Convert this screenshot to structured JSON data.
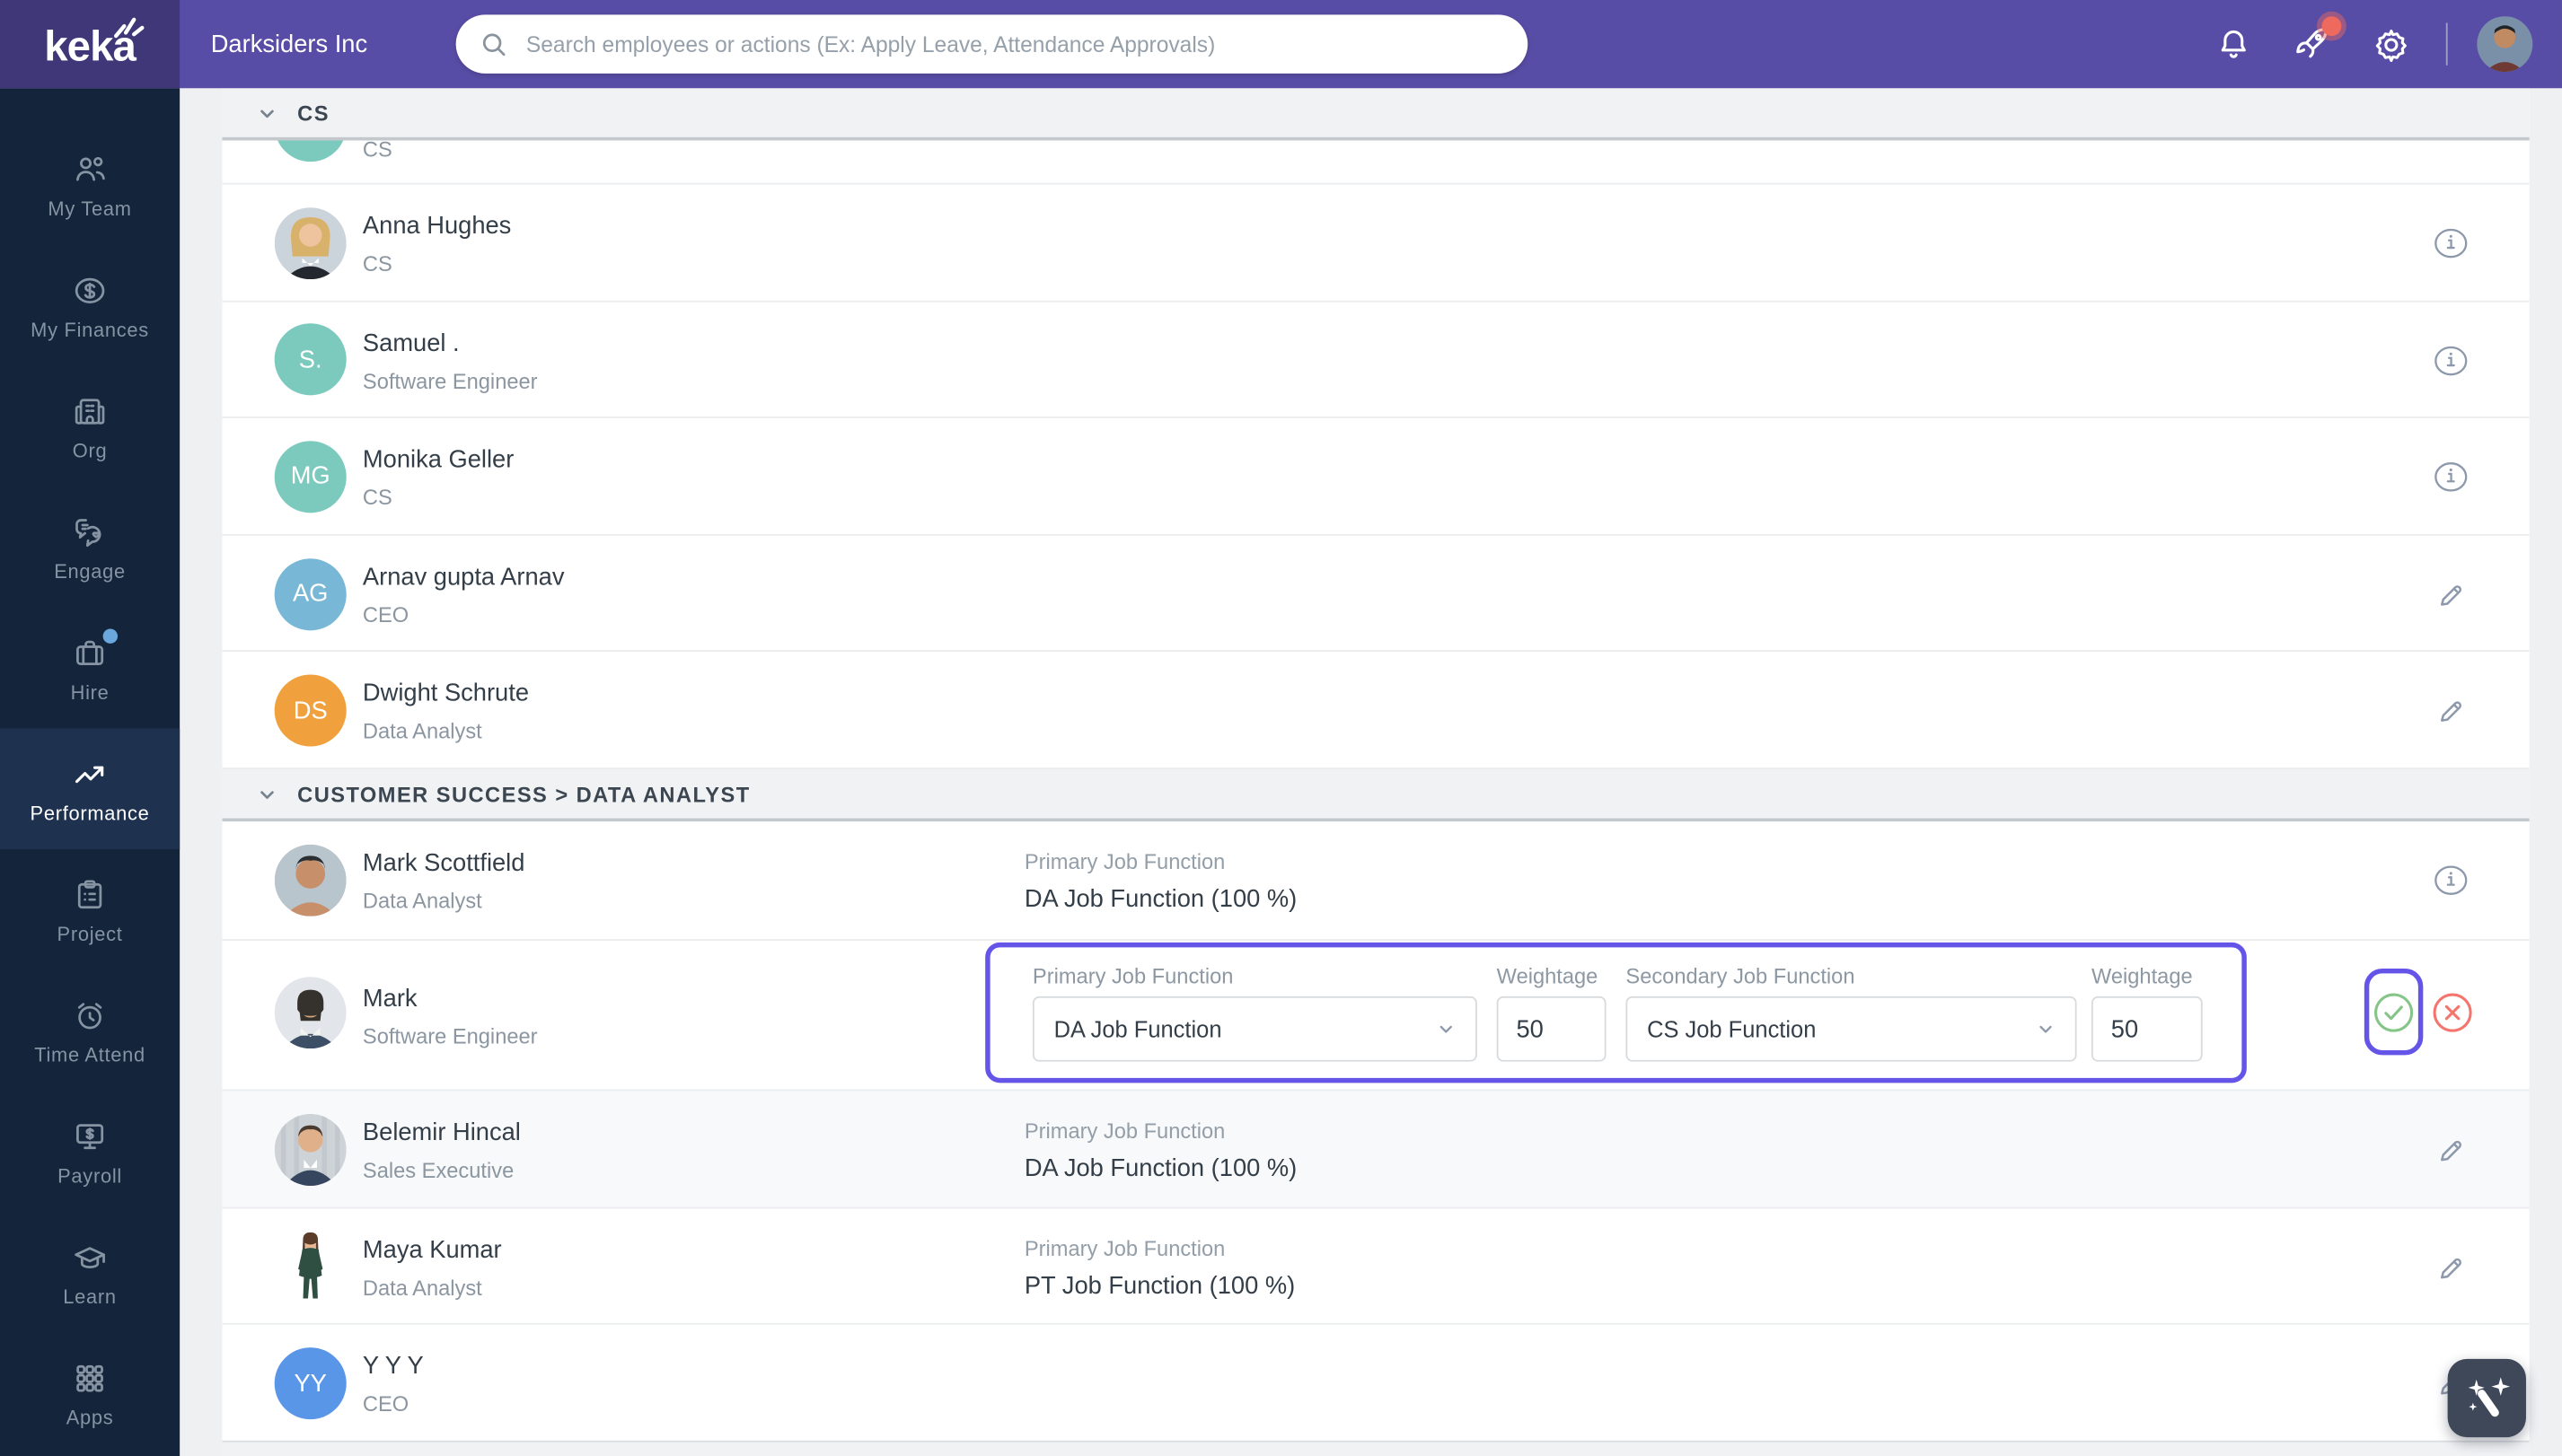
{
  "topbar": {
    "logo_text": "keka",
    "company": "Darksiders Inc",
    "search_placeholder": "Search employees or actions (Ex: Apply Leave, Attendance Approvals)"
  },
  "sidebar": {
    "items": [
      {
        "label": "My Team",
        "icon": "people-icon",
        "active": false
      },
      {
        "label": "My Finances",
        "icon": "dollar-icon",
        "active": false
      },
      {
        "label": "Org",
        "icon": "building-icon",
        "active": false
      },
      {
        "label": "Engage",
        "icon": "chat-icon",
        "active": false
      },
      {
        "label": "Hire",
        "icon": "briefcase-icon",
        "active": false,
        "badge": true
      },
      {
        "label": "Performance",
        "icon": "trend-icon",
        "active": true
      },
      {
        "label": "Project",
        "icon": "clipboard-icon",
        "active": false
      },
      {
        "label": "Time Attend",
        "icon": "alarm-clock-icon",
        "active": false
      },
      {
        "label": "Payroll",
        "icon": "payroll-icon",
        "active": false
      },
      {
        "label": "Learn",
        "icon": "graduation-cap-icon",
        "active": false
      },
      {
        "label": "Apps",
        "icon": "apps-grid-icon",
        "active": false
      }
    ]
  },
  "table": {
    "groups": [
      {
        "label": "CS",
        "partial_row": {
          "role": "CS",
          "avatar_color": "#7ccabe"
        },
        "rows": [
          {
            "name": "Anna Hughes",
            "role": "CS",
            "action": "info"
          },
          {
            "name": "Samuel .",
            "role": "Software Engineer",
            "initials": "S.",
            "avatar_color": "#7ccabe",
            "action": "info"
          },
          {
            "name": "Monika Geller",
            "role": "CS",
            "initials": "MG",
            "avatar_color": "#7ccabe",
            "action": "info"
          },
          {
            "name": "Arnav gupta Arnav",
            "role": "CEO",
            "initials": "AG",
            "avatar_color": "#79b7d6",
            "action": "edit"
          },
          {
            "name": "Dwight Schrute",
            "role": "Data Analyst",
            "initials": "DS",
            "avatar_color": "#f0a13e",
            "action": "edit"
          }
        ]
      },
      {
        "label": "CUSTOMER SUCCESS > DATA ANALYST",
        "rows": [
          {
            "name": "Mark Scottfield",
            "role": "Data Analyst",
            "job_function_label": "Primary Job Function",
            "job_function_value": "DA Job Function (100 %)",
            "action": "info"
          },
          {
            "name": "Mark",
            "role": "Software Engineer",
            "editing": true,
            "action": "confirm-cancel"
          },
          {
            "name": "Belemir Hincal",
            "role": "Sales Executive",
            "job_function_label": "Primary Job Function",
            "job_function_value": "DA Job Function (100 %)",
            "action": "edit"
          },
          {
            "name": "Maya Kumar",
            "role": "Data Analyst",
            "job_function_label": "Primary Job Function",
            "job_function_value": "PT Job Function (100 %)",
            "action": "edit"
          },
          {
            "name": "Y Y Y",
            "role": "CEO",
            "initials": "YY",
            "avatar_color": "#5a96e8",
            "action": "edit"
          }
        ]
      }
    ],
    "edit_panel": {
      "primary_label": "Primary Job Function",
      "primary_value": "DA Job Function",
      "primary_weightage_label": "Weightage",
      "primary_weightage_value": "50",
      "secondary_label": "Secondary Job Function",
      "secondary_value": "CS Job Function",
      "secondary_weightage_label": "Weightage",
      "secondary_weightage_value": "50"
    }
  },
  "colors": {
    "accent_purple": "#6554e8",
    "topbar_purple": "#584da6",
    "logo_block_purple": "#3f3778",
    "sidebar_navy": "#14253b",
    "sidebar_active": "#1e3250",
    "success_green": "#85c588",
    "danger_red": "#f3756d",
    "notification_badge_red": "#ee6a5f",
    "hire_badge_blue": "#6aa7dc",
    "fab_background": "#3e4859",
    "avatar_teal": "#7ccabe",
    "avatar_blue": "#79b7d6",
    "avatar_orange": "#f0a13e",
    "avatar_bright_blue": "#5a96e8"
  }
}
